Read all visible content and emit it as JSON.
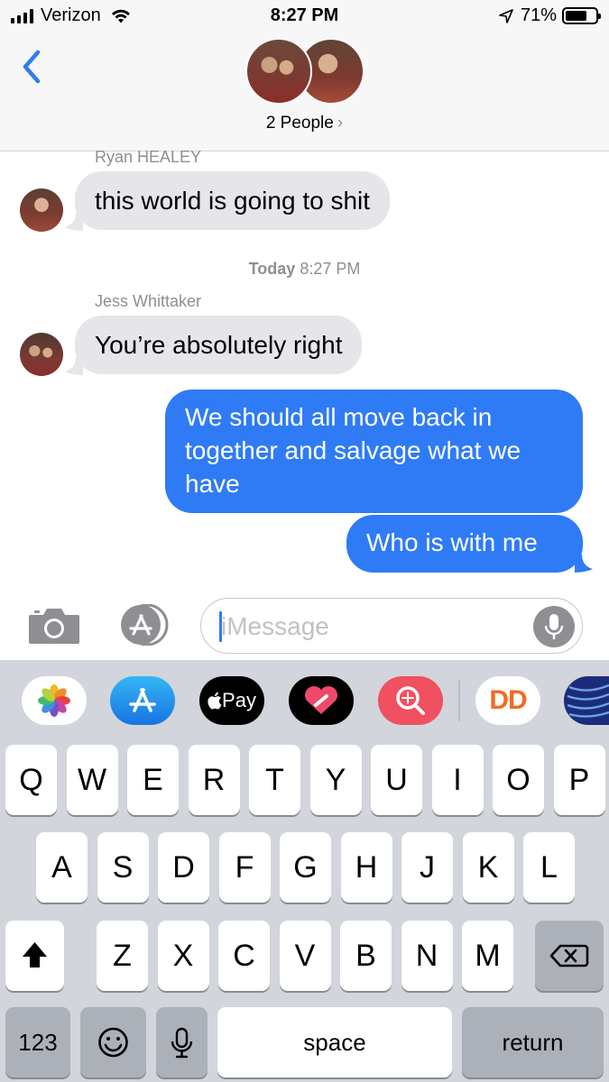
{
  "status_bar": {
    "carrier": "Verizon",
    "time": "8:27 PM",
    "battery_percent": "71%",
    "battery_level": 0.71,
    "signal_bars": 4,
    "icons": [
      "signal-bars-icon",
      "wifi-icon",
      "location-arrow-icon",
      "battery-icon"
    ]
  },
  "header": {
    "back_icon": "chevron-left-icon",
    "people_label": "2 People",
    "people_chevron": "›"
  },
  "conversation": {
    "messages": [
      {
        "sender": "Ryan HEALEY",
        "direction": "incoming",
        "text": "this world is going to shit"
      },
      {
        "sender": "Jess Whittaker",
        "direction": "incoming",
        "text": "You’re absolutely right"
      },
      {
        "sender": "me",
        "direction": "outgoing",
        "text_lines": [
          "We should all move back in",
          "together and salvage what we",
          "have"
        ]
      },
      {
        "sender": "me",
        "direction": "outgoing",
        "text": "Who is with me"
      }
    ],
    "timestamp": {
      "day": "Today",
      "time": "8:27 PM"
    }
  },
  "input_bar": {
    "placeholder": "iMessage",
    "value": "",
    "icons": [
      "camera-icon",
      "app-store-icon",
      "microphone-icon"
    ]
  },
  "app_drawer": {
    "apps": [
      "photos-icon",
      "app-store-icon",
      "apple-pay-icon",
      "digital-touch-icon",
      "search-images-icon",
      "dunkin-icon",
      "united-airlines-icon"
    ],
    "apple_pay_label": "Pay",
    "dunkin_label": "DD"
  },
  "keyboard": {
    "row1": [
      "Q",
      "W",
      "E",
      "R",
      "T",
      "Y",
      "U",
      "I",
      "O",
      "P"
    ],
    "row2": [
      "A",
      "S",
      "D",
      "F",
      "G",
      "H",
      "J",
      "K",
      "L"
    ],
    "row3": [
      "Z",
      "X",
      "C",
      "V",
      "B",
      "N",
      "M"
    ],
    "numbers_label": "123",
    "space_label": "space",
    "return_label": "return",
    "icons": [
      "shift-icon",
      "delete-icon",
      "emoji-icon",
      "dictation-mic-icon"
    ]
  },
  "colors": {
    "outgoing_bubble": "#2f7bf5",
    "incoming_bubble": "#e5e5ea",
    "keyboard_bg": "#d2d5db",
    "ios_blue": "#2f7bf5"
  }
}
